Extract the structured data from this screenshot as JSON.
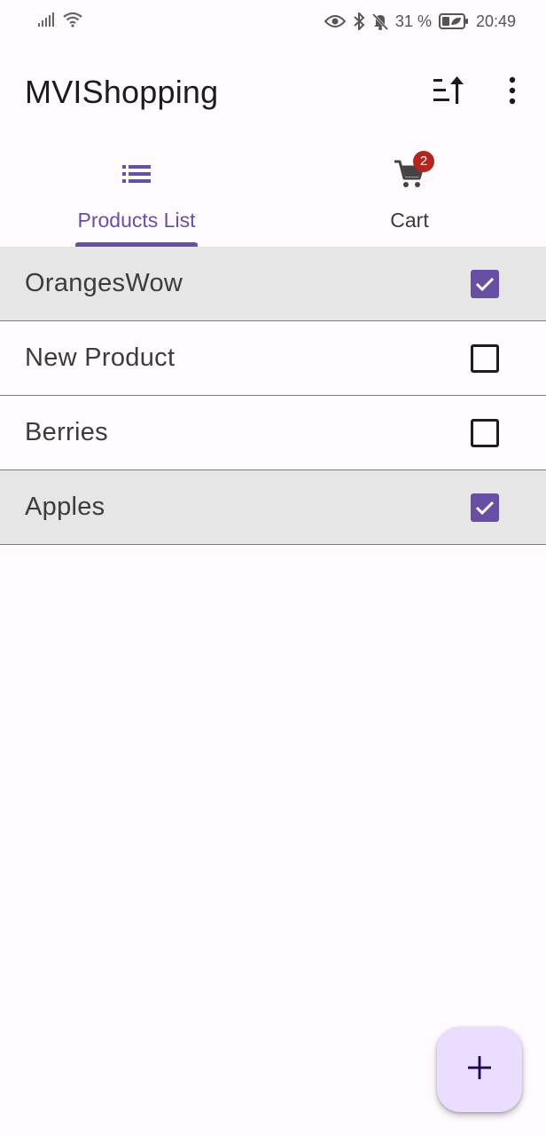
{
  "status_bar": {
    "battery_percent": "31 %",
    "time": "20:49",
    "icons": [
      "signal-icon",
      "wifi-icon",
      "eye-icon",
      "bluetooth-icon",
      "mute-icon",
      "battery-icon"
    ]
  },
  "app_bar": {
    "title": "MVIShopping",
    "sort_icon": "sort-icon",
    "more_icon": "more-vert-icon"
  },
  "tabs": [
    {
      "label": "Products List",
      "icon": "list-icon",
      "selected": true
    },
    {
      "label": "Cart",
      "icon": "cart-icon",
      "badge": "2",
      "selected": false
    }
  ],
  "products": [
    {
      "name": "OrangesWow",
      "checked": true
    },
    {
      "name": "New Product",
      "checked": false
    },
    {
      "name": "Berries",
      "checked": false
    },
    {
      "name": "Apples",
      "checked": true
    }
  ],
  "fab": {
    "icon": "add-icon"
  },
  "colors": {
    "primary": "#6750a4",
    "selected_row": "#e6e6e6",
    "badge": "#b3261e",
    "fab_container": "#eaddff",
    "background": "#fffbfe"
  }
}
